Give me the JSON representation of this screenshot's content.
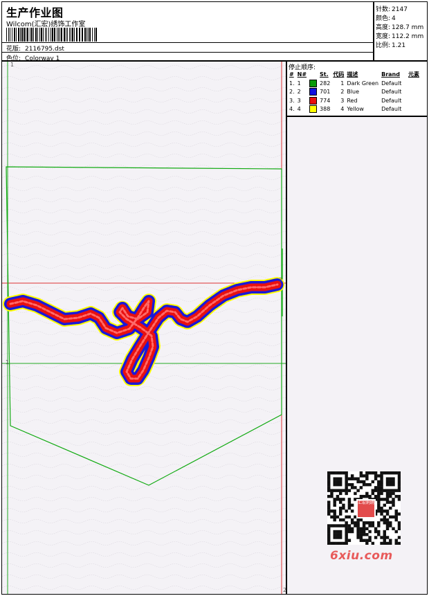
{
  "header": {
    "title": "生产作业图",
    "subtitle": "Wilcom(汇宏)绣饰工作室",
    "design_label": "花版:",
    "design_value": "2116795.dst",
    "color_label": "色位:",
    "color_value": "Colorway 1"
  },
  "stats": [
    {
      "label": "针数:",
      "value": "2147"
    },
    {
      "label": "颜色:",
      "value": "4"
    },
    {
      "label": "高度:",
      "value": "128.7 mm"
    },
    {
      "label": "宽度:",
      "value": "112.2 mm"
    },
    {
      "label": "比例:",
      "value": "1.21"
    }
  ],
  "stop_sequence": {
    "title": "停止顺序:",
    "columns": [
      "#",
      "N#",
      "St.",
      "代码",
      "描述",
      "Brand",
      "元素"
    ],
    "rows": [
      {
        "idx": "1.",
        "n": "1",
        "color": "#0a9a0a",
        "st": "282",
        "code": "1",
        "desc": "Dark Green",
        "brand": "Default"
      },
      {
        "idx": "2.",
        "n": "2",
        "color": "#1010e0",
        "st": "701",
        "code": "2",
        "desc": "Blue",
        "brand": "Default"
      },
      {
        "idx": "3.",
        "n": "3",
        "color": "#e81010",
        "st": "774",
        "code": "3",
        "desc": "Red",
        "brand": "Default"
      },
      {
        "idx": "4.",
        "n": "4",
        "color": "#ffff00",
        "st": "388",
        "code": "4",
        "desc": "Yellow",
        "brand": "Default"
      }
    ]
  },
  "markers": {
    "top_left": "1",
    "mid_left": "1",
    "right_cross": "2",
    "bottom_right": "2"
  },
  "watermark": {
    "logo_text": "汇宏刺绣",
    "site": "6xiu.com"
  },
  "colors": {
    "outline": "#11aa11",
    "guide": "#dd3333",
    "stitch_red": "#e81010",
    "stitch_blue": "#1a1ad8",
    "stitch_yellow": "#ffff00"
  }
}
